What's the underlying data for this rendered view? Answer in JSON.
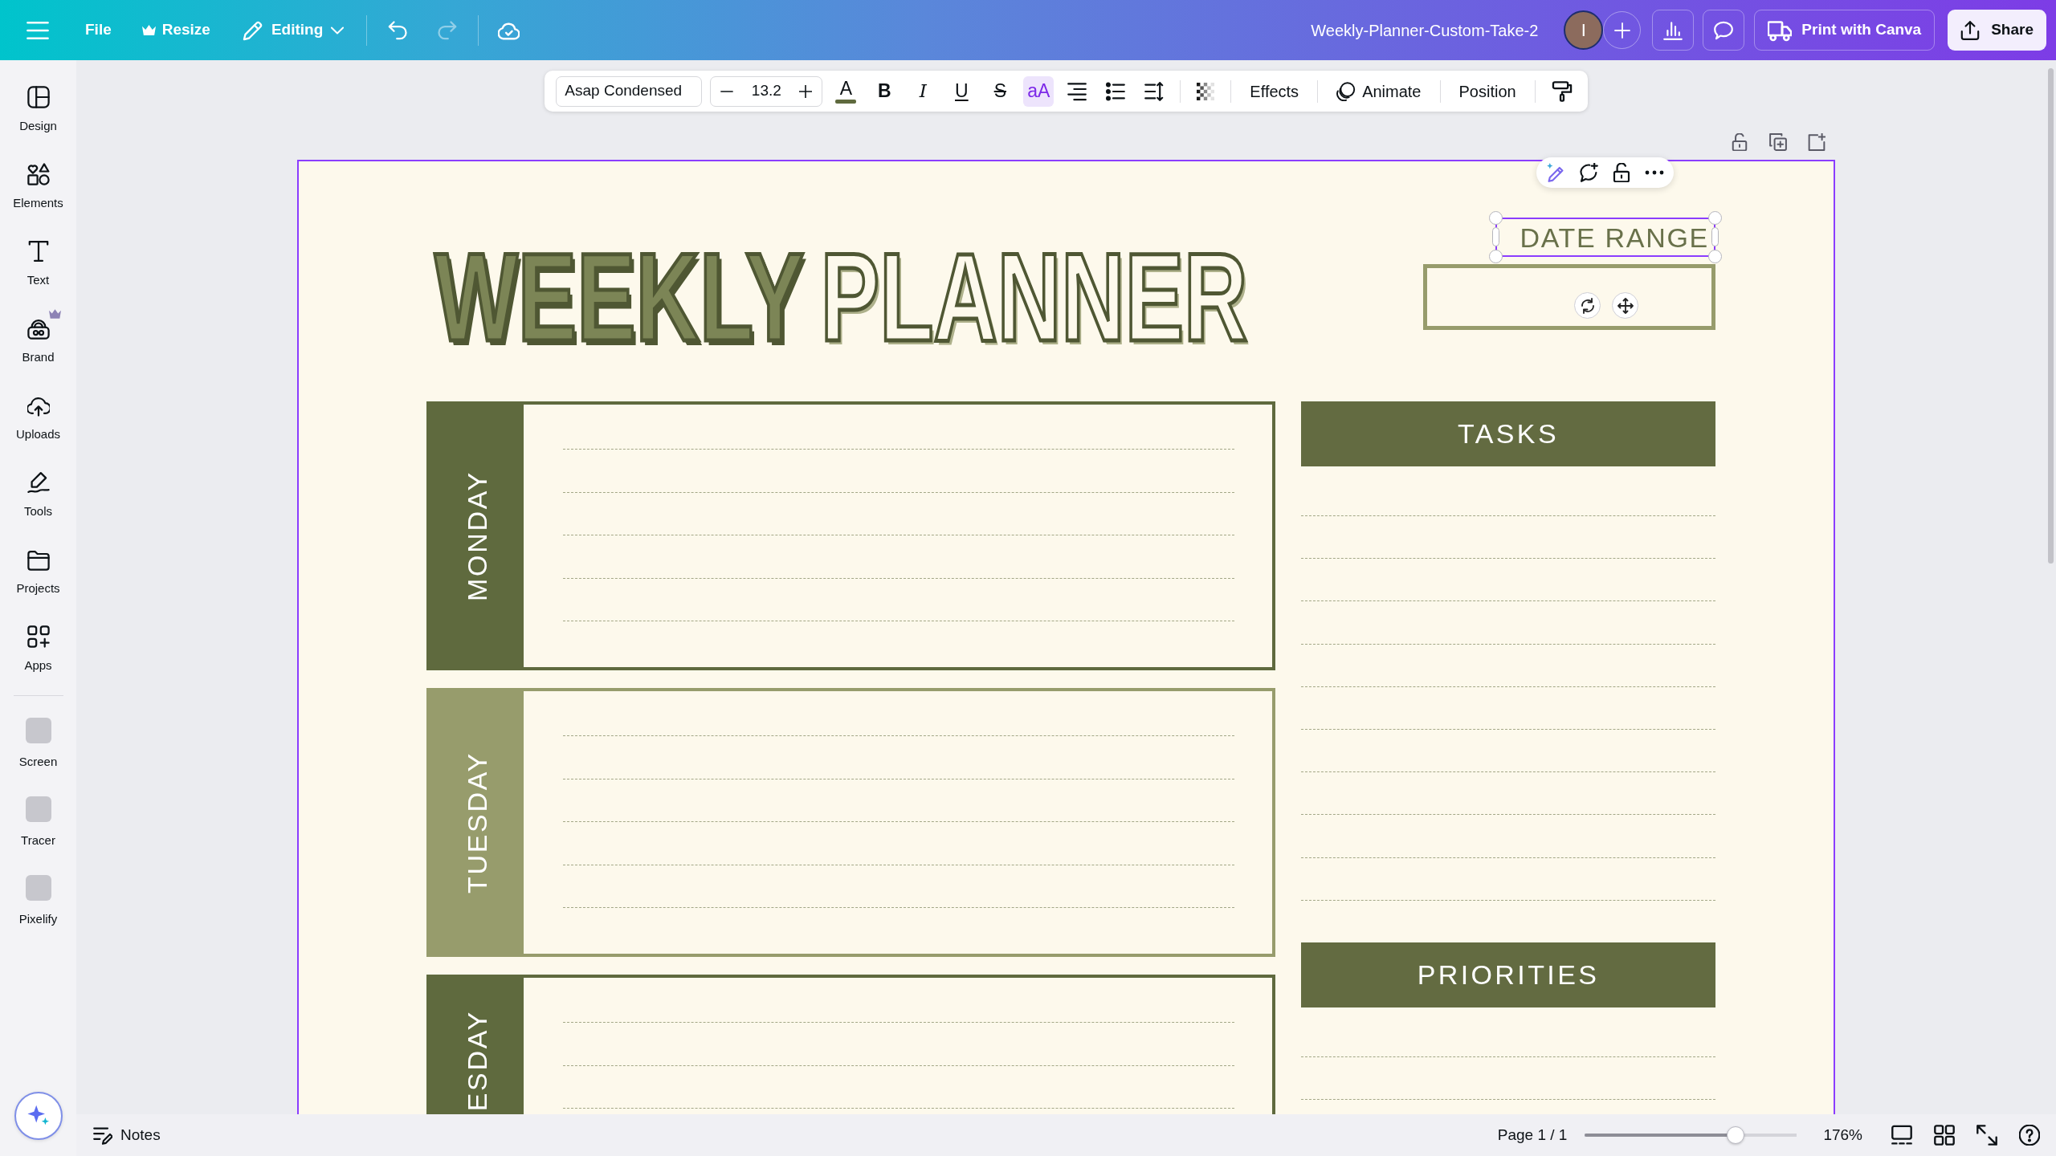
{
  "top_bar": {
    "file_menu": "File",
    "resize_button": "Resize",
    "mode_button": "Editing",
    "undo": {
      "disabled": false
    },
    "redo": {
      "disabled": true
    },
    "document_title": "Weekly-Planner-Custom-Take-2",
    "avatar_initial": "I",
    "print_button": "Print with Canva",
    "share_button": "Share"
  },
  "text_toolbar": {
    "font_family": "Asap Condensed",
    "font_size": "13.2",
    "text_color": {
      "label": "A",
      "color": "#5f6a3e"
    },
    "format_buttons": [
      {
        "kind": "bold",
        "label": "B",
        "selected": false
      },
      {
        "kind": "italic",
        "label": "I",
        "selected": false
      },
      {
        "kind": "underline",
        "label": "U",
        "selected": false
      },
      {
        "kind": "strikethrough",
        "label": "S",
        "selected": false
      },
      {
        "kind": "case",
        "label": "aA",
        "selected": true
      }
    ],
    "effects_button": "Effects",
    "animate_button": "Animate",
    "position_button": "Position"
  },
  "sidebar": {
    "items": [
      {
        "kind": "tool",
        "label": "Design",
        "crown": false
      },
      {
        "kind": "tool",
        "label": "Elements",
        "crown": false
      },
      {
        "kind": "tool",
        "label": "Text",
        "crown": false
      },
      {
        "kind": "tool",
        "label": "Brand",
        "crown": true
      },
      {
        "kind": "tool",
        "label": "Uploads",
        "crown": false
      },
      {
        "kind": "tool",
        "label": "Tools",
        "crown": false
      },
      {
        "kind": "tool",
        "label": "Projects",
        "crown": false
      },
      {
        "kind": "tool",
        "label": "Apps",
        "crown": false
      },
      {
        "kind": "app",
        "label": "Screen",
        "crown": false
      },
      {
        "kind": "app",
        "label": "Tracer",
        "crown": false
      },
      {
        "kind": "app",
        "label": "Pixelify",
        "crown": false
      }
    ]
  },
  "page": {
    "title_words": [
      {
        "text": "WEEKLY",
        "filled": true
      },
      {
        "text": "PLANNER",
        "filled": false
      }
    ],
    "date_range": {
      "label": "DATE RANGE",
      "selected": true
    },
    "days": [
      {
        "name": "MONDAY",
        "color": "#5f6a3e"
      },
      {
        "name": "TUESDAY",
        "color": "#979c6c"
      },
      {
        "name": "ESDAY",
        "color": "#5f6a3e"
      }
    ],
    "sections": [
      {
        "heading": "TASKS"
      },
      {
        "heading": "PRIORITIES"
      }
    ]
  },
  "bottom_bar": {
    "notes_button": "Notes",
    "page_indicator": "Page 1 / 1",
    "zoom": {
      "level": 0.71,
      "reading": "176%"
    }
  }
}
